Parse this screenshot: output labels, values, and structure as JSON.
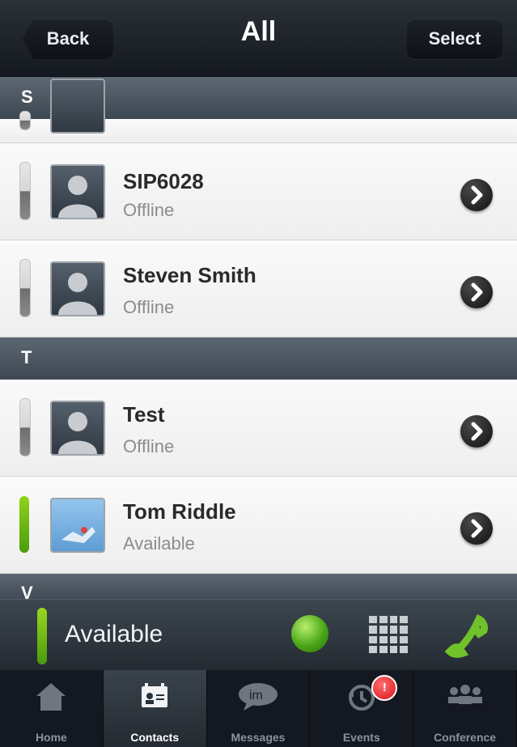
{
  "navbar": {
    "back_label": "Back",
    "title": "All",
    "select_label": "Select"
  },
  "sections": {
    "s": "S",
    "t": "T",
    "v": "V"
  },
  "contacts": [
    {
      "name": "SIP6028",
      "status": "Offline"
    },
    {
      "name": "Steven Smith",
      "status": "Offline"
    },
    {
      "name": "Test",
      "status": "Offline"
    },
    {
      "name": "Tom Riddle",
      "status": "Available"
    }
  ],
  "presence": {
    "label": "Available"
  },
  "tabs": [
    {
      "label": "Home"
    },
    {
      "label": "Contacts"
    },
    {
      "label": "Messages"
    },
    {
      "label": "Events",
      "badge": "!"
    },
    {
      "label": "Conference"
    }
  ],
  "colors": {
    "available_green": "#5bb31a",
    "badge_red": "#d9121a",
    "header": "#47525c"
  },
  "icons": [
    "home-icon",
    "contacts-icon",
    "im-icon",
    "history-icon",
    "conference-icon",
    "keypad-icon",
    "phone-icon",
    "chevron-right-icon"
  ]
}
